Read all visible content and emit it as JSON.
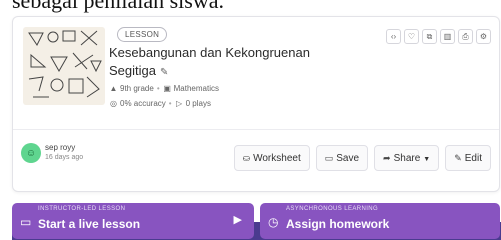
{
  "doc": {
    "top_text": "sebagai penilaian siswa."
  },
  "lesson": {
    "badge": "LESSON",
    "title": "Kesebangunan dan Kekongruenan Segitiga",
    "grade": "9th grade",
    "subject": "Mathematics",
    "accuracy": "0% accuracy",
    "plays": "0 plays"
  },
  "author": {
    "name": "sep royy",
    "time": "16 days ago"
  },
  "icons": [
    "embed-icon",
    "heart-icon",
    "copy-icon",
    "trash-icon",
    "print-icon",
    "settings-icon"
  ],
  "actions": {
    "worksheet": "Worksheet",
    "save": "Save",
    "share": "Share",
    "edit": "Edit"
  },
  "launch": {
    "live_kicker": "INSTRUCTOR-LED LESSON",
    "live_label": "Start a live lesson",
    "hw_kicker": "ASYNCHRONOUS LEARNING",
    "hw_label": "Assign homework"
  },
  "colors": {
    "accent": "#8854c0",
    "avatar": "#5fd58f",
    "bar": "#4a3b8f"
  }
}
